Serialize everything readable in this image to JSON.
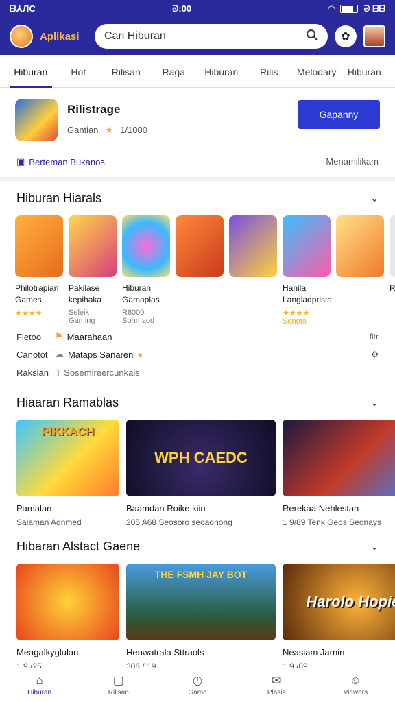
{
  "status": {
    "left": "ᗷ⅄ЛC",
    "time": "ᘒ:00",
    "right": "ᘒ ᗷᗷ"
  },
  "app": {
    "brand": "Aplikasi",
    "search_value": "Cari Hiburan"
  },
  "tabs": [
    "Hiburan",
    "Hot",
    "Rilisan",
    "Raga",
    "Hiburan",
    "Rilis",
    "Melodary",
    "Hiburan"
  ],
  "featured": {
    "title": "Rilistrage",
    "meta": "Gantian",
    "rating": "1/1000",
    "install_label": "Gapanny",
    "link_text": "Berteman Bukanos",
    "right_text": "Menamilikam"
  },
  "section1": {
    "title": "Hiburan Hiarals",
    "apps": [
      {
        "name": "Philotrapian Games",
        "rating": "★★★★"
      },
      {
        "name": "Pakilase kepihaka kanionosaiun",
        "rating": "Seleik Gaming"
      },
      {
        "name": "Hiburan Gamaplas Antariak",
        "rating": "R8000 Sohmaod"
      },
      {
        "name": "",
        "rating": ""
      },
      {
        "name": "",
        "rating": ""
      },
      {
        "name": "Hanila Langladpristan Canana",
        "rating": "★★★★ Senoto"
      },
      {
        "name": "",
        "rating": ""
      },
      {
        "name": "R",
        "rating": ""
      }
    ]
  },
  "list": [
    {
      "left": "Fletoo",
      "middle": "Maarahaan",
      "right": "fitr"
    },
    {
      "left": "Canotot",
      "middle": "Mataps Sanaren",
      "right": "⚙"
    },
    {
      "left": "Rakslan",
      "middle": "Sosemireercunkais",
      "right": ""
    }
  ],
  "section2": {
    "title": "Hiaaran Ramablas",
    "cards": [
      {
        "name": "Pamalan",
        "meta": "Salaman Adnmed",
        "img_text": "PIKKACH"
      },
      {
        "name": "Baamdan Roike kiin",
        "meta": "205 A68 Seosoro seoaonong",
        "img_text": "WPH CAEDC"
      },
      {
        "name": "Rerekaa Nehlestan",
        "meta": "1 9/89 Tenk Geos Seonays",
        "img_text": ""
      }
    ]
  },
  "section3": {
    "title": "Hibaran Alstact Gaene",
    "cards": [
      {
        "name": "Meagalkyglulan",
        "meta": "1 9 /25",
        "img_text": ""
      },
      {
        "name": "Henwatrala Sttraols",
        "meta": "306 / 19",
        "img_text": "THE FSMH JAY BOT"
      },
      {
        "name": "Neasiam Jarnin",
        "meta": "1 9 /89",
        "img_text": "Harolo Hopiek"
      }
    ]
  },
  "nav": [
    {
      "label": "Hiburan",
      "icon": "home-icon"
    },
    {
      "label": "Rilisan",
      "icon": "apps-icon"
    },
    {
      "label": "Game",
      "icon": "clock-icon"
    },
    {
      "label": "Plasis",
      "icon": "mail-icon"
    },
    {
      "label": "Viewers",
      "icon": "person-icon"
    }
  ],
  "colors": {
    "accent": "#2b2a9c",
    "button": "#2b3ad1",
    "star": "#f2b21c"
  }
}
